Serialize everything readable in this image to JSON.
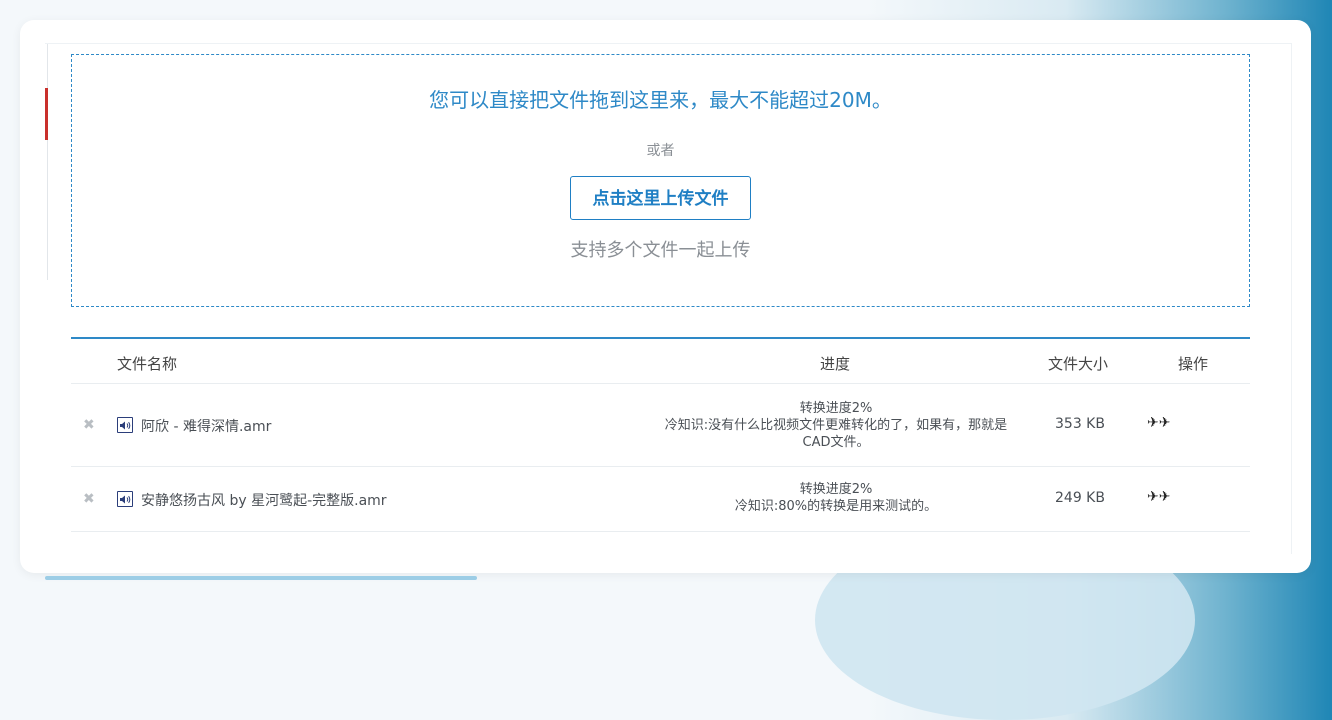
{
  "dropzone": {
    "title": "您可以直接把文件拖到这里来，最大不能超过20M。",
    "or": "或者",
    "upload_button": "点击这里上传文件",
    "hint": "支持多个文件一起上传"
  },
  "table": {
    "headers": {
      "name": "文件名称",
      "progress": "进度",
      "size": "文件大小",
      "action": "操作"
    },
    "rows": [
      {
        "remove": "✖",
        "icon": "audio-file-icon",
        "name": "阿欣 - 难得深情.amr",
        "progress_status": "转换进度2%",
        "progress_tip": "冷知识:没有什么比视频文件更难转化的了，如果有，那就是CAD文件。",
        "size": "353 KB",
        "action": "✈✈"
      },
      {
        "remove": "✖",
        "icon": "audio-file-icon",
        "name": "安静悠扬古风 by 星河鹭起-完整版.amr",
        "progress_status": "转换进度2%",
        "progress_tip": "冷知识:80%的转换是用来测试的。",
        "size": "249 KB",
        "action": "✈✈"
      }
    ]
  },
  "colors": {
    "accent": "#2e89c7",
    "button": "#1f7fc4",
    "muted": "#8a8f95"
  }
}
